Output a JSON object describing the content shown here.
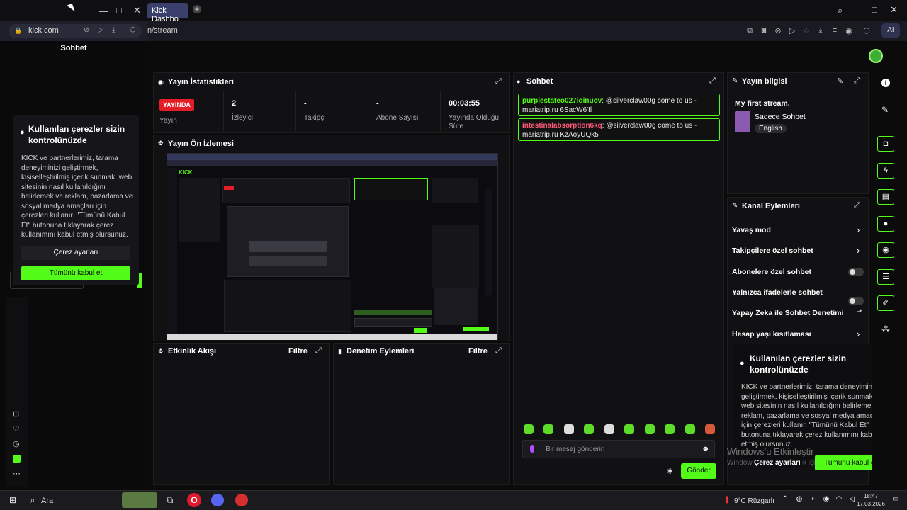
{
  "browser": {
    "tab_title": "Kick Dashbo",
    "url_domain": "kick.com",
    "url_path": "n/stream",
    "ai_label": "AI"
  },
  "sidebar": {
    "title": "Sohbet",
    "nav_icons": [
      "grid-icon",
      "heart-icon",
      "clock-icon",
      "box-icon",
      "more-icon"
    ]
  },
  "cookie": {
    "title": "Kullanılan çerezler sizin kontrolünüzde",
    "body_left": "KICK ve partnerlerimiz, tarama deneyiminizi geliştirmek, kişiselleştirilmiş içerik sunmak, web sitesinin nasıl kullanıldığını belirlemek ve reklam, pazarlama ve sosyal medya amaçları için çerezleri kullanır. \"Tümünü Kabul Et\" butonuna tıklayarak çerez kullanımını kabul etmiş olursunuz.",
    "body_right": "KICK ve partnerlerimiz, tarama deneyiminizi geliştirmek, kişiselleştirilmiş içerik sunmak, web sitesinin nasıl kullanıldığını belirlemek ve reklam, pazarlama ve sosyal medya amaçları için çerezleri kullanır. \"Tümünü Kabul Et\" butonuna tıklayarak çerez kullanımını kabul etmiş olursunuz.",
    "settings_label": "Çerez ayarları",
    "settings_label_right": "Çerez ayarları",
    "accept_label": "Tümünü kabul et",
    "accept_label_right": "Tümünü kabul et"
  },
  "stats": {
    "title": "Yayın İstatistikleri",
    "live_badge": "YAYINDA",
    "items": [
      {
        "value": "",
        "label": "Yayın"
      },
      {
        "value": "2",
        "label": "İzleyici"
      },
      {
        "value": "-",
        "label": "Takipçi"
      },
      {
        "value": "-",
        "label": "Abone Sayısı"
      },
      {
        "value": "00:03:55",
        "label": "Yayında Olduğu Süre"
      }
    ]
  },
  "preview": {
    "title": "Yayın Ön İzlemesi",
    "mini_logo": "KICK"
  },
  "activity": {
    "title": "Etkinlik Akışı",
    "filter": "Filtre"
  },
  "moderation": {
    "title": "Denetim Eylemleri",
    "filter": "Filtre"
  },
  "chat": {
    "title": "Sohbet",
    "messages": [
      {
        "user": "purplestateo027ioinuov",
        "text": ": @silverclaw00g come to us - mariatrip.ru 6SacW6'Il"
      },
      {
        "user": "intestinalabsorption6kq",
        "text": ": @silverclaw00g come to us - mariatrip.ru KzAoyUQk5"
      }
    ],
    "input_placeholder": "Bir mesaj gönderin",
    "send_label": "Gönder"
  },
  "stream_info": {
    "title": "Yayın bilgisi",
    "stream_title": "My first stream.",
    "category": "Sadece Sohbet",
    "language": "English"
  },
  "channel_actions": {
    "title": "Kanal Eylemleri",
    "rows": [
      {
        "label": "Yavaş mod",
        "control": "chevron"
      },
      {
        "label": "Takipçilere özel sohbet",
        "control": "chevron"
      },
      {
        "label": "Abonelere özel sohbet",
        "control": "toggle"
      },
      {
        "label": "Yalnızca ifadelerle sohbet",
        "control": "toggle"
      },
      {
        "label": "Yapay Zeka ile Sohbet Denetimi",
        "control": "external"
      },
      {
        "label": "Hesap yaşı kısıtlaması",
        "control": "chevron"
      }
    ]
  },
  "windows_watermark": {
    "line1": "Windows'u Etkinleştir",
    "line2": "Windows'u etkinleştirmek için"
  },
  "taskbar": {
    "search_label": "Ara",
    "weather": "9°C Rüzgarlı",
    "time": "18:47",
    "date": "17.03.2026"
  },
  "colors": {
    "brand_green": "#53fc18",
    "live_red": "#e31c25",
    "bg": "#0b0b0c"
  }
}
